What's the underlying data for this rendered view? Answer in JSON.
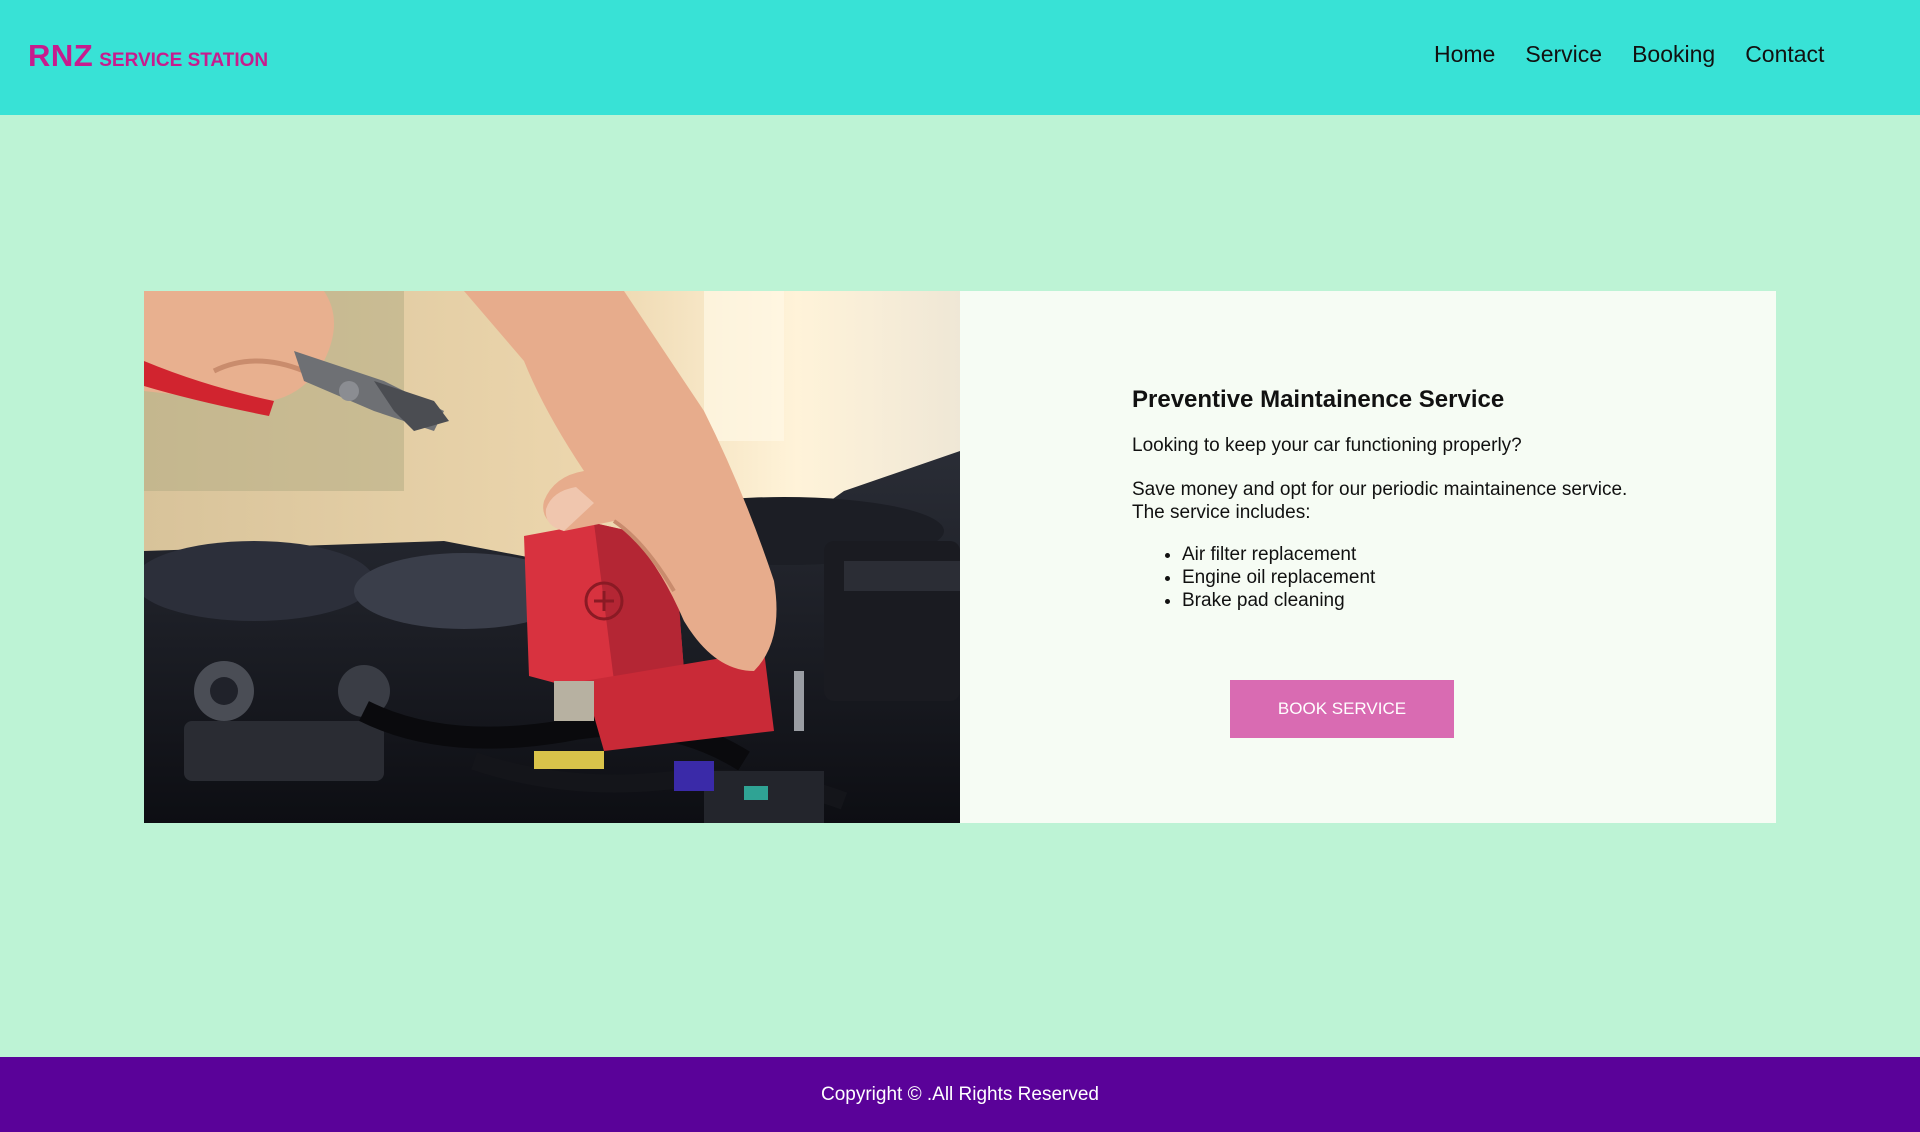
{
  "brand": {
    "name": "RNZ",
    "tagline": "SERVICE STATION"
  },
  "nav": {
    "items": [
      "Home",
      "Service",
      "Booking",
      "Contact"
    ]
  },
  "service": {
    "title": "Preventive Maintainence Service",
    "intro": "Looking to keep your car functioning properly?",
    "description_line1": "Save money and opt for our periodic maintainence service.",
    "description_line2": "The service includes:",
    "features": [
      "Air filter replacement",
      "Engine oil replacement",
      "Brake pad cleaning"
    ],
    "cta_label": "BOOK SERVICE"
  },
  "footer": {
    "copyright": "Copyright © .All Rights Reserved"
  },
  "colors": {
    "header_bg": "#38e2d6",
    "page_bg": "#bdf3d5",
    "card_bg": "#f6fcf4",
    "brand": "#c71c8e",
    "button": "#d96bb2",
    "footer_bg": "#5a0299"
  },
  "images": {
    "hero": "mechanic-hands-car-battery-photo"
  }
}
